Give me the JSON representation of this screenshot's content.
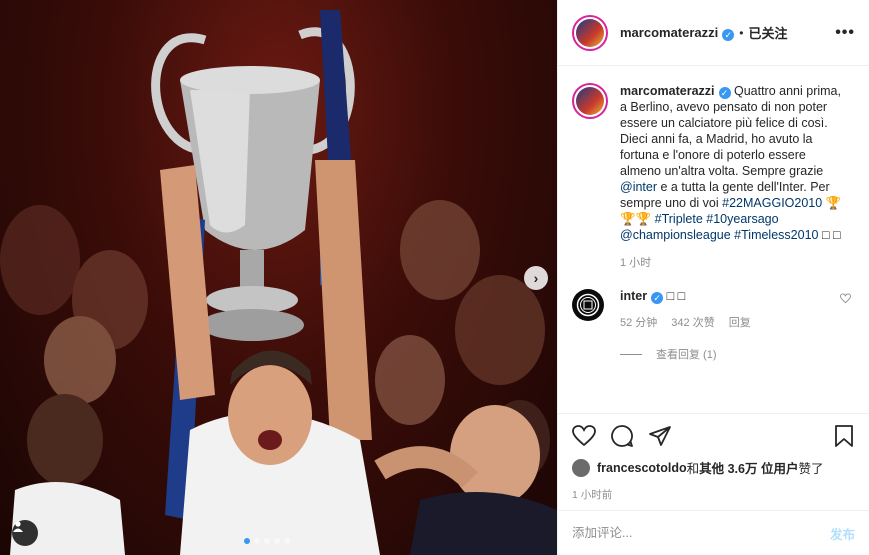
{
  "post": {
    "username": "marcomaterazzi",
    "follow_state": "已关注",
    "more_glyph": "•••",
    "verified_glyph": "✓",
    "separator": "•"
  },
  "caption": {
    "username": "marcomaterazzi",
    "text_1": " Quattro anni prima, a Berlino, avevo pensato di non poter essere un calciatore più felice di così. Dieci anni fa, a Madrid, ho avuto la fortuna e l'onore di poterlo essere almeno un'altra volta. Sempre grazie ",
    "mention_inter": "@inter",
    "text_2": " e a tutta la gente dell'Inter. Per sempre uno di voi ",
    "hashtag_1": "#22MAGGIO2010",
    "trophies": " 🏆🏆🏆",
    "hashtag_2": "#Triplete",
    "hashtag_3": "#10yearsago",
    "mention_cl": "@championsleague",
    "hashtag_4": "#Timeless2010",
    "end_glyphs": " □ □",
    "time": "1 小时"
  },
  "comment": {
    "username": "inter",
    "text": " □ □",
    "time": "52 分钟",
    "likes": "342 次赞",
    "reply": "回复",
    "view_replies": "查看回复 (1)"
  },
  "likes": {
    "user": "francescotoldo",
    "rest": " 和 ",
    "others": "其他 3.6万 位用户",
    "suffix": " 赞了"
  },
  "posted_time": "1 小时前",
  "add_comment": {
    "placeholder": "添加评论...",
    "post_label": "发布"
  },
  "icons": {
    "next": "chevron-right-icon",
    "tag": "person-tag-icon",
    "like": "heart-icon",
    "comment": "comment-icon",
    "share": "paper-plane-icon",
    "save": "bookmark-icon"
  },
  "colors": {
    "link": "#00376b",
    "verified": "#3897f0",
    "muted": "#8e8e8e",
    "post_button_disabled": "#b2dffc",
    "story_ring": "#d6249f"
  }
}
